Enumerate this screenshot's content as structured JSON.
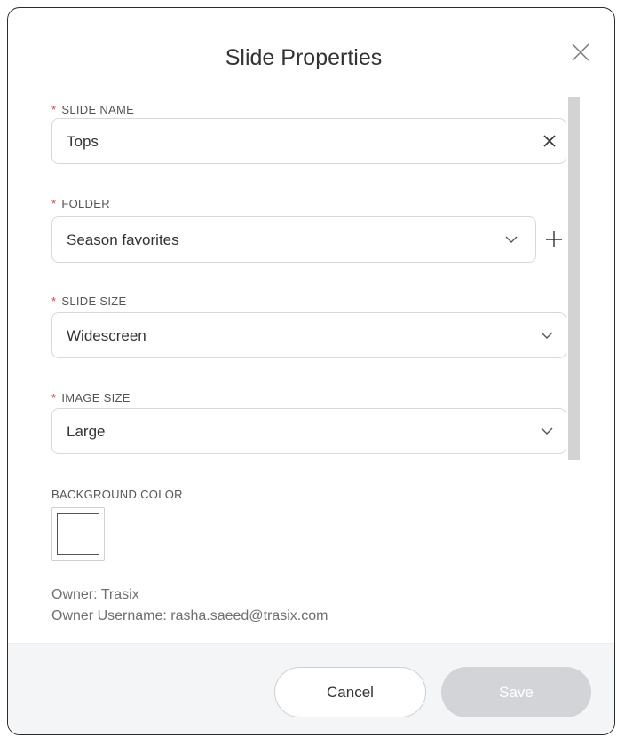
{
  "dialog": {
    "title": "Slide Properties"
  },
  "fields": {
    "slide_name": {
      "label": "SLIDE NAME",
      "value": "Tops"
    },
    "folder": {
      "label": "FOLDER",
      "value": "Season favorites"
    },
    "slide_size": {
      "label": "SLIDE SIZE",
      "value": "Widescreen"
    },
    "image_size": {
      "label": "IMAGE SIZE",
      "value": "Large"
    },
    "background_color": {
      "label": "BACKGROUND COLOR",
      "color": "#ffffff"
    },
    "required_marker": "*"
  },
  "owner": {
    "owner_line": "Owner: Trasix",
    "username_line": "Owner Username: rasha.saeed@trasix.com"
  },
  "footer": {
    "cancel_label": "Cancel",
    "save_label": "Save"
  },
  "colors": {
    "required": "#e0403a",
    "save_disabled": "#d2d4d8"
  },
  "icons": {
    "close": "close-icon",
    "clear": "clear-icon",
    "dropdown": "chevron-down-icon",
    "add": "plus-icon"
  }
}
